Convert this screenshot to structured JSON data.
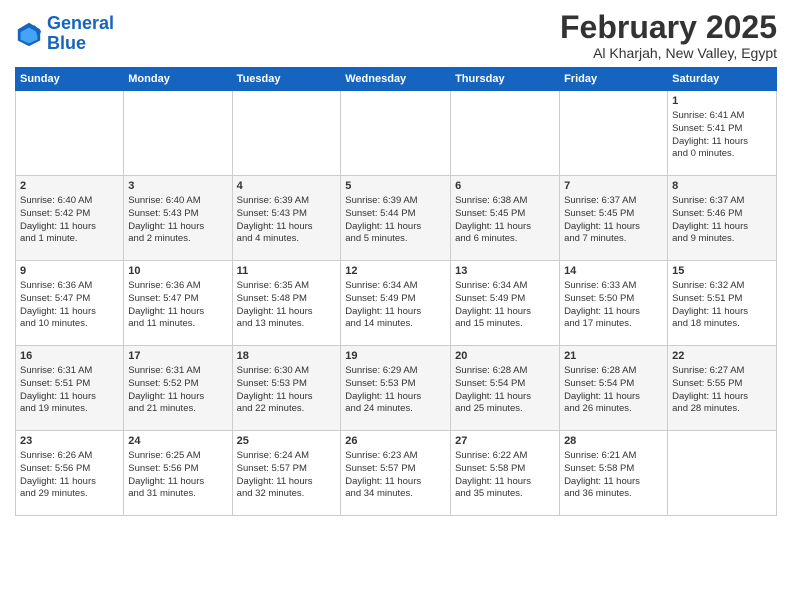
{
  "logo": {
    "line1": "General",
    "line2": "Blue"
  },
  "title": "February 2025",
  "subtitle": "Al Kharjah, New Valley, Egypt",
  "headers": [
    "Sunday",
    "Monday",
    "Tuesday",
    "Wednesday",
    "Thursday",
    "Friday",
    "Saturday"
  ],
  "weeks": [
    {
      "shaded": false,
      "days": [
        {
          "num": "",
          "text": ""
        },
        {
          "num": "",
          "text": ""
        },
        {
          "num": "",
          "text": ""
        },
        {
          "num": "",
          "text": ""
        },
        {
          "num": "",
          "text": ""
        },
        {
          "num": "",
          "text": ""
        },
        {
          "num": "1",
          "text": "Sunrise: 6:41 AM\nSunset: 5:41 PM\nDaylight: 11 hours\nand 0 minutes."
        }
      ]
    },
    {
      "shaded": true,
      "days": [
        {
          "num": "2",
          "text": "Sunrise: 6:40 AM\nSunset: 5:42 PM\nDaylight: 11 hours\nand 1 minute."
        },
        {
          "num": "3",
          "text": "Sunrise: 6:40 AM\nSunset: 5:43 PM\nDaylight: 11 hours\nand 2 minutes."
        },
        {
          "num": "4",
          "text": "Sunrise: 6:39 AM\nSunset: 5:43 PM\nDaylight: 11 hours\nand 4 minutes."
        },
        {
          "num": "5",
          "text": "Sunrise: 6:39 AM\nSunset: 5:44 PM\nDaylight: 11 hours\nand 5 minutes."
        },
        {
          "num": "6",
          "text": "Sunrise: 6:38 AM\nSunset: 5:45 PM\nDaylight: 11 hours\nand 6 minutes."
        },
        {
          "num": "7",
          "text": "Sunrise: 6:37 AM\nSunset: 5:45 PM\nDaylight: 11 hours\nand 7 minutes."
        },
        {
          "num": "8",
          "text": "Sunrise: 6:37 AM\nSunset: 5:46 PM\nDaylight: 11 hours\nand 9 minutes."
        }
      ]
    },
    {
      "shaded": false,
      "days": [
        {
          "num": "9",
          "text": "Sunrise: 6:36 AM\nSunset: 5:47 PM\nDaylight: 11 hours\nand 10 minutes."
        },
        {
          "num": "10",
          "text": "Sunrise: 6:36 AM\nSunset: 5:47 PM\nDaylight: 11 hours\nand 11 minutes."
        },
        {
          "num": "11",
          "text": "Sunrise: 6:35 AM\nSunset: 5:48 PM\nDaylight: 11 hours\nand 13 minutes."
        },
        {
          "num": "12",
          "text": "Sunrise: 6:34 AM\nSunset: 5:49 PM\nDaylight: 11 hours\nand 14 minutes."
        },
        {
          "num": "13",
          "text": "Sunrise: 6:34 AM\nSunset: 5:49 PM\nDaylight: 11 hours\nand 15 minutes."
        },
        {
          "num": "14",
          "text": "Sunrise: 6:33 AM\nSunset: 5:50 PM\nDaylight: 11 hours\nand 17 minutes."
        },
        {
          "num": "15",
          "text": "Sunrise: 6:32 AM\nSunset: 5:51 PM\nDaylight: 11 hours\nand 18 minutes."
        }
      ]
    },
    {
      "shaded": true,
      "days": [
        {
          "num": "16",
          "text": "Sunrise: 6:31 AM\nSunset: 5:51 PM\nDaylight: 11 hours\nand 19 minutes."
        },
        {
          "num": "17",
          "text": "Sunrise: 6:31 AM\nSunset: 5:52 PM\nDaylight: 11 hours\nand 21 minutes."
        },
        {
          "num": "18",
          "text": "Sunrise: 6:30 AM\nSunset: 5:53 PM\nDaylight: 11 hours\nand 22 minutes."
        },
        {
          "num": "19",
          "text": "Sunrise: 6:29 AM\nSunset: 5:53 PM\nDaylight: 11 hours\nand 24 minutes."
        },
        {
          "num": "20",
          "text": "Sunrise: 6:28 AM\nSunset: 5:54 PM\nDaylight: 11 hours\nand 25 minutes."
        },
        {
          "num": "21",
          "text": "Sunrise: 6:28 AM\nSunset: 5:54 PM\nDaylight: 11 hours\nand 26 minutes."
        },
        {
          "num": "22",
          "text": "Sunrise: 6:27 AM\nSunset: 5:55 PM\nDaylight: 11 hours\nand 28 minutes."
        }
      ]
    },
    {
      "shaded": false,
      "days": [
        {
          "num": "23",
          "text": "Sunrise: 6:26 AM\nSunset: 5:56 PM\nDaylight: 11 hours\nand 29 minutes."
        },
        {
          "num": "24",
          "text": "Sunrise: 6:25 AM\nSunset: 5:56 PM\nDaylight: 11 hours\nand 31 minutes."
        },
        {
          "num": "25",
          "text": "Sunrise: 6:24 AM\nSunset: 5:57 PM\nDaylight: 11 hours\nand 32 minutes."
        },
        {
          "num": "26",
          "text": "Sunrise: 6:23 AM\nSunset: 5:57 PM\nDaylight: 11 hours\nand 34 minutes."
        },
        {
          "num": "27",
          "text": "Sunrise: 6:22 AM\nSunset: 5:58 PM\nDaylight: 11 hours\nand 35 minutes."
        },
        {
          "num": "28",
          "text": "Sunrise: 6:21 AM\nSunset: 5:58 PM\nDaylight: 11 hours\nand 36 minutes."
        },
        {
          "num": "",
          "text": ""
        }
      ]
    }
  ]
}
